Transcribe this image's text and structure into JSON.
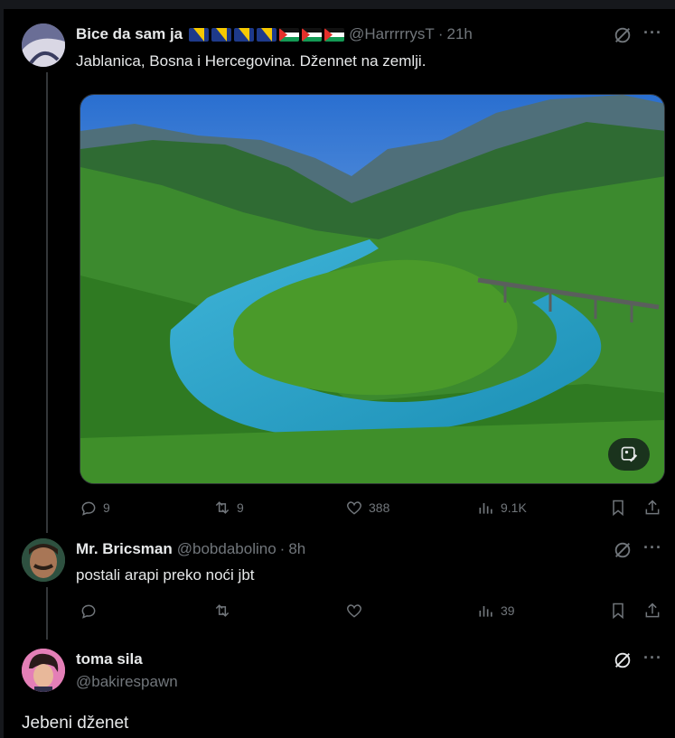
{
  "tweets": [
    {
      "name": "Bice da sam ja",
      "handle": "@HarrrrrysT",
      "time": "21h",
      "text": "Jablanica, Bosna i Hercegovina. Džennet na zemlji.",
      "flags": [
        "bosnia",
        "bosnia",
        "bosnia",
        "bosnia",
        "palestine",
        "palestine",
        "palestine"
      ],
      "replies": "9",
      "reposts": "9",
      "likes": "388",
      "views": "9.1K"
    },
    {
      "name": "Mr. Bricsman",
      "handle": "@bobdabolino",
      "time": "8h",
      "text": "postali arapi preko noći jbt",
      "replies": "",
      "reposts": "",
      "likes": "",
      "views": "39"
    },
    {
      "name": "toma sila",
      "handle": "@bakirespawn",
      "text": "Jebeni dženet"
    }
  ],
  "separator": "·",
  "more_glyph": "···",
  "colors": {
    "text": "#e7e9ea",
    "muted": "#71767b",
    "bg": "#000000",
    "border": "#2f3336"
  }
}
